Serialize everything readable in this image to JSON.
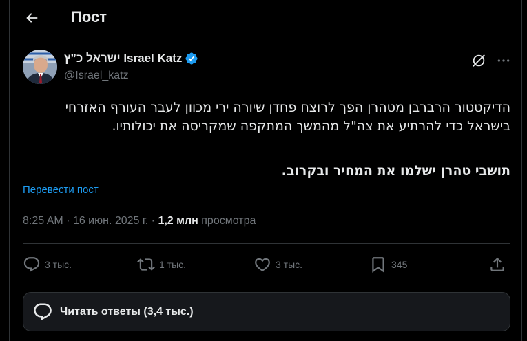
{
  "header": {
    "title": "Пост",
    "back_icon": "arrow-left-icon"
  },
  "author": {
    "name": "ישראל כ”ץ Israel Katz",
    "handle": "@Israel_katz",
    "verified_icon": "verified-badge-icon",
    "verified_color": "#1d9bf0"
  },
  "tweet": {
    "paragraph1": "הדיקטטור הרברבן מטהרן הפך לרוצח פחדן שיורה ירי מכוון לעבר העורף האזרחי בישראל כדי להרתיע את צה\"ל מהמשך המתקפה שמקריסה את יכולותיו.",
    "paragraph2": "תושבי טהרן ישלמו את המחיר ובקרוב.",
    "translate": "Перевести пост",
    "time": "8:25 AM",
    "date": "16 июн. 2025 г.",
    "views_count": "1,2 млн",
    "views_label": "просмотра"
  },
  "actions": {
    "reply": {
      "icon": "reply-icon",
      "count": "3 тыс."
    },
    "repost": {
      "icon": "repost-icon",
      "count": "1 тыс."
    },
    "like": {
      "icon": "heart-icon",
      "count": "3 тыс."
    },
    "bookmark": {
      "icon": "bookmark-icon",
      "count": "345"
    },
    "share": {
      "icon": "share-icon"
    }
  },
  "read_replies": {
    "label": "Читать ответы (3,4 тыс.)",
    "icon": "speech-bubble-icon"
  },
  "colors": {
    "background": "#000000",
    "text": "#e7e9ea",
    "secondary": "#71767b",
    "accent": "#1d9bf0",
    "border": "#2f3336"
  }
}
